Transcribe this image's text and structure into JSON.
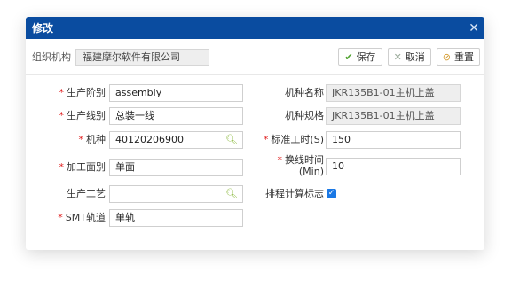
{
  "dialog": {
    "title": "修改",
    "close_icon": "✕"
  },
  "toolbar": {
    "org_label": "组织机构",
    "org_value": "福建摩尔软件有限公司",
    "save_label": "保存",
    "cancel_label": "取消",
    "reset_label": "重置"
  },
  "form": {
    "required_mark": "*",
    "stage": {
      "label": "生产阶别",
      "value": "assembly"
    },
    "line": {
      "label": "生产线别",
      "value": "总装一线"
    },
    "model": {
      "label": "机种",
      "value": "40120206900"
    },
    "surface": {
      "label": "加工面别",
      "value": "单面"
    },
    "process": {
      "label": "生产工艺",
      "value": ""
    },
    "smt_track": {
      "label": "SMT轨道",
      "value": "单轨"
    },
    "model_name": {
      "label": "机种名称",
      "value": "JKR135B1-01主机上盖"
    },
    "model_spec": {
      "label": "机种规格",
      "value": "JKR135B1-01主机上盖"
    },
    "std_time": {
      "label": "标准工时(S)",
      "value": "150"
    },
    "changeover_time": {
      "label": "换线时间(Min)",
      "label_line1": "换线时间",
      "label_line2": "(Min)",
      "value": "10"
    },
    "schedule_flag": {
      "label": "排程计算标志",
      "checked": true
    }
  }
}
